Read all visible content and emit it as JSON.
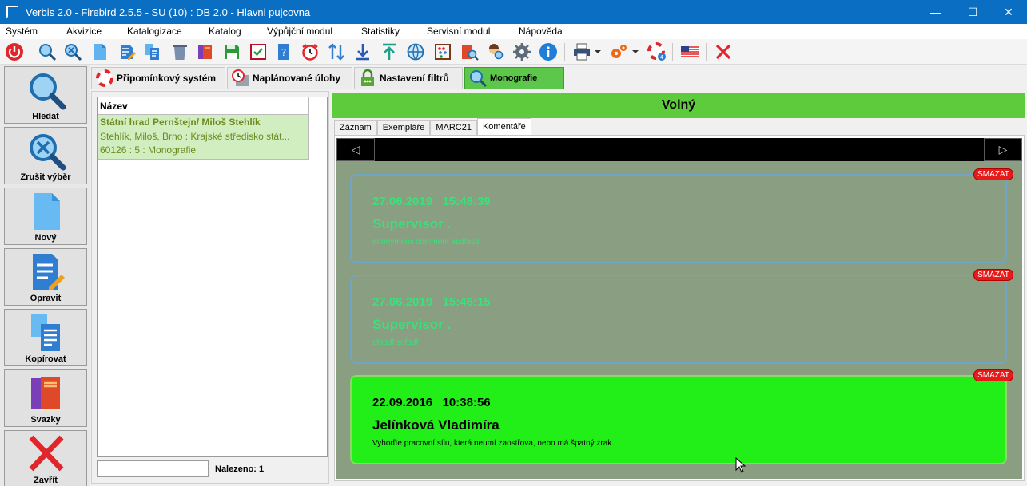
{
  "window": {
    "title": "Verbis 2.0 - Firebird 2.5.5 - SU (10) : DB 2.0 - Hlavni pujcovna",
    "min": "—",
    "max": "☐",
    "close": "✕"
  },
  "menu": [
    "Systém",
    "Akvizice",
    "Katalogizace",
    "Katalog",
    "Výpůjční modul",
    "Statistiky",
    "Servisní modul",
    "Nápověda"
  ],
  "leftbar": {
    "buttons": [
      "Hledat",
      "Zrušit výběr",
      "Nový",
      "Opravit",
      "Kopírovat",
      "Svazky",
      "Zavřít"
    ]
  },
  "tabs": [
    "Připomínkový systém",
    "Naplánované úlohy",
    "Nastavení filtrů",
    "Monografie"
  ],
  "grid": {
    "header": "Název",
    "row": {
      "title": "Státní hrad Pernštejn/ Miloš Stehlík",
      "line2": "Stehlík, Miloš, Brno : Krajské středisko stát...",
      "line3": "60126 : 5 : Monografie"
    },
    "found_label": "Nalezeno: 1"
  },
  "detail": {
    "status": "Volný",
    "subtabs": [
      "Záznam",
      "Exempláře",
      "MARC21",
      "Komentáře"
    ],
    "nav_prev": "◁",
    "nav_next": "▷",
    "delete_label": "SMAZAT",
    "comments": [
      {
        "date": "27.06.2019",
        "time": "15:48:39",
        "user": "Supervisor .",
        "text": "anonymous comment asdfasd"
      },
      {
        "date": "27.06.2019",
        "time": "15:46:15",
        "user": "Supervisor .",
        "text": "dfsgdf sdfgdf"
      },
      {
        "date": "22.09.2016",
        "time": "10:38:56",
        "user": "Jelínková Vladimíra",
        "text": "Vyhoďte pracovní sílu, která neumí zaostřova, nebo má špatný zrak."
      }
    ]
  }
}
